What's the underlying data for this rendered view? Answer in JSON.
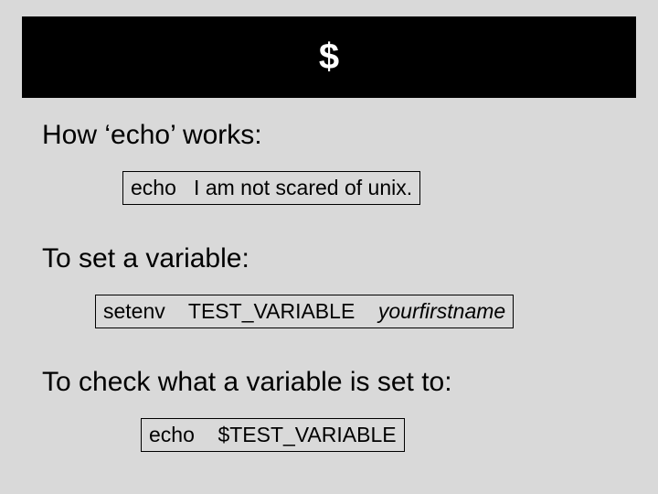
{
  "title": "$",
  "sections": {
    "s1": {
      "heading": "How ‘echo’ works:"
    },
    "s2": {
      "heading": "To set a variable:"
    },
    "s3": {
      "heading": "To check what a variable is set to:"
    }
  },
  "cmd1": {
    "command": "echo",
    "args": "I am not scared of unix."
  },
  "cmd2": {
    "command": "setenv",
    "arg1": "TEST_VARIABLE",
    "arg2_italic": "yourfirstname"
  },
  "cmd3": {
    "command": "echo",
    "args": "$TEST_VARIABLE"
  }
}
